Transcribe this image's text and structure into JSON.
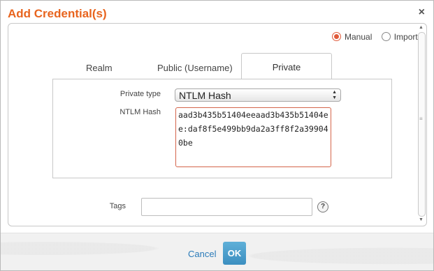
{
  "dialog": {
    "title": "Add Credential(s)",
    "close_glyph": "×"
  },
  "mode": {
    "options": [
      {
        "label": "Manual",
        "selected": true
      },
      {
        "label": "Import",
        "selected": false
      }
    ]
  },
  "tabs": {
    "realm": "Realm",
    "public": "Public (Username)",
    "private": "Private",
    "active": "Private"
  },
  "form": {
    "private_type_label": "Private type",
    "private_type_value": "NTLM Hash",
    "ntlm_hash_label": "NTLM Hash",
    "ntlm_hash_value": "aad3b435b51404eeaad3b435b51404ee:daf8f5e499bb9da2a3ff8f2a399040be",
    "tags_label": "Tags",
    "tags_value": "",
    "help_glyph": "?"
  },
  "footer": {
    "cancel_label": "Cancel",
    "ok_label": "OK"
  },
  "colors": {
    "accent": "#e8641e",
    "link": "#2b7bb9",
    "ok_button": "#4a9fd0"
  }
}
